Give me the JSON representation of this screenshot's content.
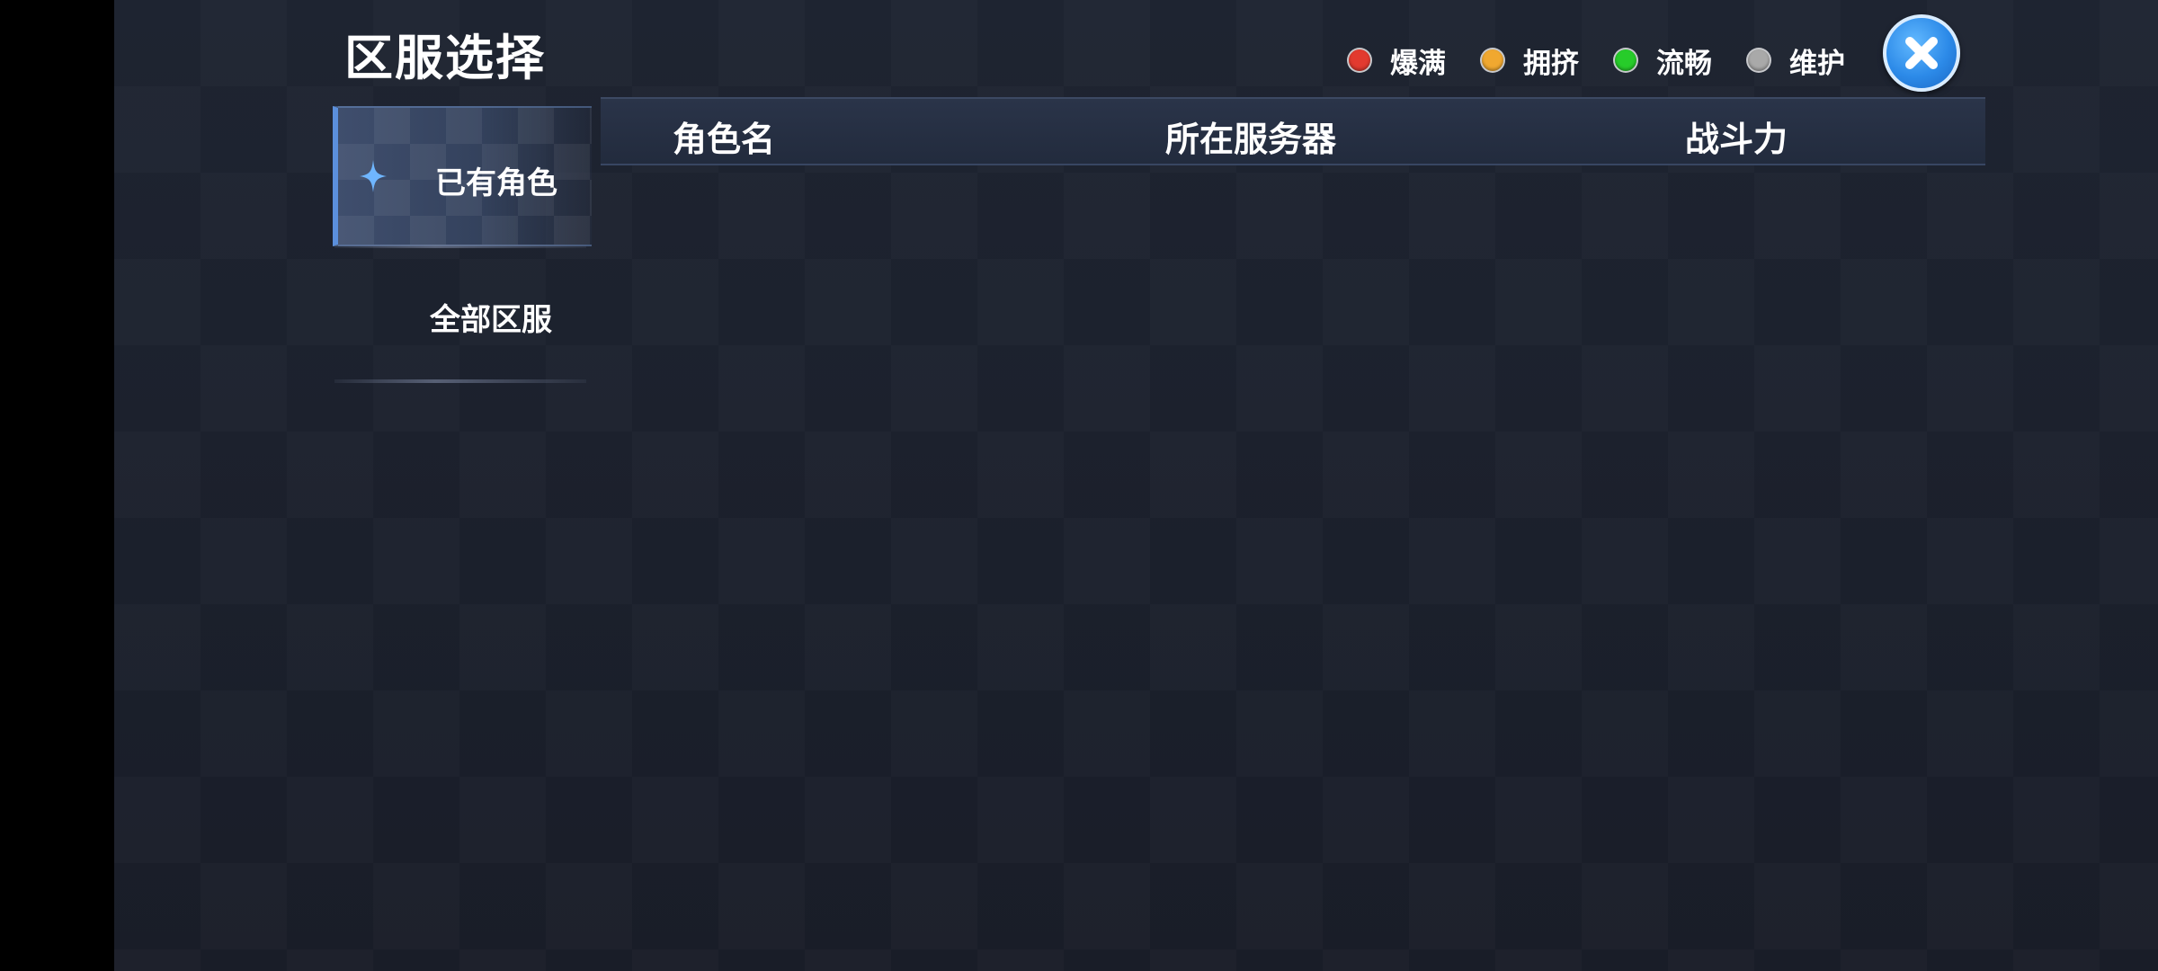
{
  "title": "区服选择",
  "legend": [
    {
      "label": "爆满",
      "color": "#e23a2f"
    },
    {
      "label": "拥挤",
      "color": "#f0a830"
    },
    {
      "label": "流畅",
      "color": "#27cc2a"
    },
    {
      "label": "维护",
      "color": "#a9a9a9"
    }
  ],
  "close_icon": "close-x-icon",
  "tabs": [
    {
      "label": "已有角色",
      "icon": "sparkle-star-icon",
      "active": true
    },
    {
      "label": "全部区服",
      "active": false
    }
  ],
  "table": {
    "columns": [
      "角色名",
      "所在服务器",
      "战斗力"
    ],
    "rows": []
  },
  "colors": {
    "accent": "#5b8fdc",
    "close_button": "#2c8ae8",
    "background": "#1b202c"
  }
}
